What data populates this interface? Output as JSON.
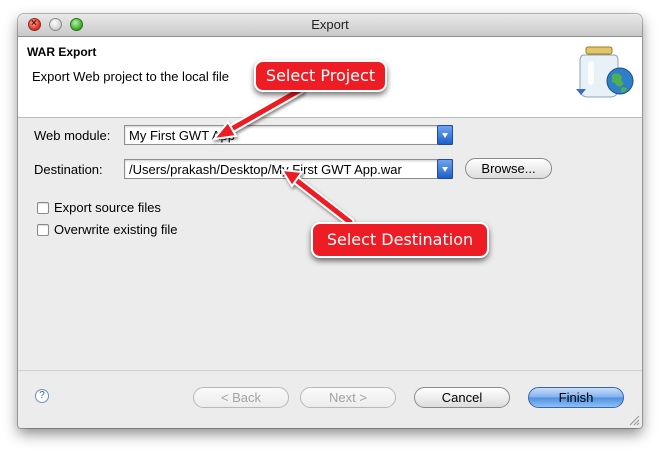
{
  "window": {
    "title": "Export"
  },
  "banner": {
    "title": "WAR Export",
    "description": "Export Web project to the local file",
    "icon": "jar-with-globe-icon"
  },
  "form": {
    "web_module_label": "Web module:",
    "web_module_value": "My First GWT App",
    "destination_label": "Destination:",
    "destination_value": "/Users/prakash/Desktop/My First GWT App.war",
    "browse_label": "Browse...",
    "export_source_label": "Export source files",
    "export_source_checked": false,
    "overwrite_label": "Overwrite existing file",
    "overwrite_checked": false
  },
  "footer": {
    "help_icon": "help-icon",
    "back_label": "< Back",
    "next_label": "Next >",
    "cancel_label": "Cancel",
    "finish_label": "Finish"
  },
  "annotations": {
    "select_project": "Select Project",
    "select_destination": "Select Destination",
    "color": "#ee1c24"
  }
}
